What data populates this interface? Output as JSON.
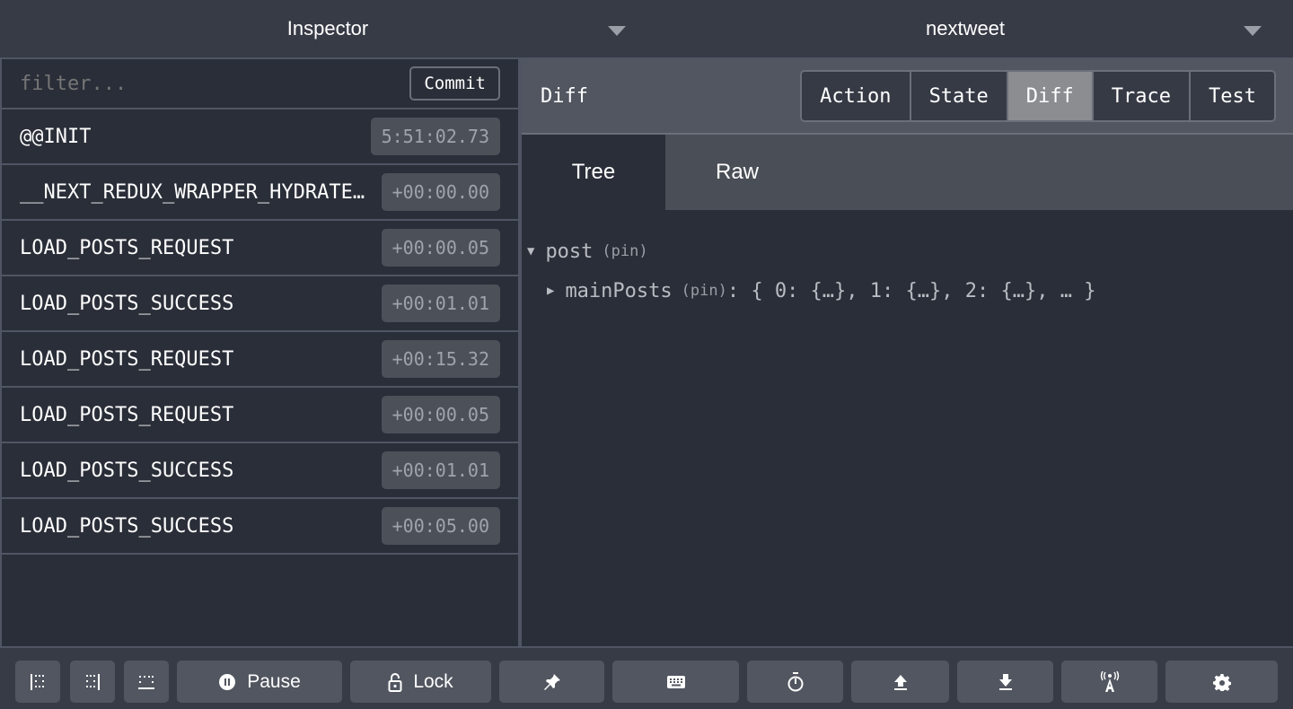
{
  "topbar": {
    "monitor": "Inspector",
    "instance": "nextweet"
  },
  "filter": {
    "placeholder": "filter...",
    "commit_label": "Commit"
  },
  "actions": [
    {
      "name": "@@INIT",
      "time": "5:51:02.73"
    },
    {
      "name": "__NEXT_REDUX_WRAPPER_HYDRATE__",
      "time": "+00:00.00"
    },
    {
      "name": "LOAD_POSTS_REQUEST",
      "time": "+00:00.05"
    },
    {
      "name": "LOAD_POSTS_SUCCESS",
      "time": "+00:01.01"
    },
    {
      "name": "LOAD_POSTS_REQUEST",
      "time": "+00:15.32"
    },
    {
      "name": "LOAD_POSTS_REQUEST",
      "time": "+00:00.05"
    },
    {
      "name": "LOAD_POSTS_SUCCESS",
      "time": "+00:01.01"
    },
    {
      "name": "LOAD_POSTS_SUCCESS",
      "time": "+00:05.00"
    }
  ],
  "detail": {
    "title": "Diff",
    "tabs": [
      "Action",
      "State",
      "Diff",
      "Trace",
      "Test"
    ],
    "active_tab": "Diff",
    "subtabs": [
      "Tree",
      "Raw"
    ],
    "tree": {
      "root_key": "post",
      "root_pin": "(pin)",
      "child_key": "mainPosts",
      "child_pin": "(pin)",
      "child_value": ": { 0: {…}, 1: {…}, 2: {…}, … }"
    }
  },
  "bottom": {
    "pause_label": "Pause",
    "lock_label": "Lock"
  }
}
